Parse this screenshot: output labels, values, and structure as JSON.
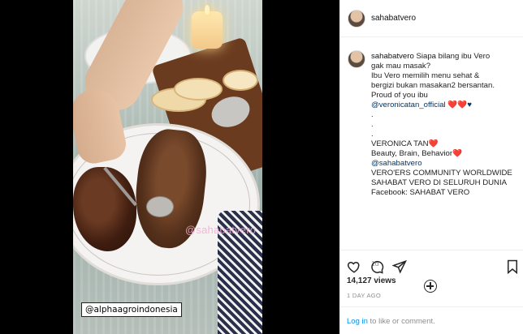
{
  "post": {
    "username": "sahabatvero",
    "watermark": "@sahabatvero",
    "video_tag": "@alphaagroindonesia",
    "caption": {
      "username": "sahabatvero",
      "lines": [
        "Siapa bilang ibu Vero",
        "gak mau masak?",
        "Ibu Vero memilih menu sehat &",
        "bergizi bukan masakan2 bersantan.",
        "Proud of you ibu",
        "@veronicatan_official ❤️❤️♥",
        ".",
        ".",
        ".",
        "VERONICA TAN❤️",
        "Beauty, Brain, Behavior❤️",
        "@sahabatvero",
        "VERO'ERS COMMUNITY WORLDWIDE",
        "SAHABAT VERO DI SELURUH DUNIA",
        "Facebook: SAHABAT VERO"
      ]
    },
    "age_short": "1d",
    "views_label": "14,127 views",
    "age_long": "1 DAY AGO",
    "login_link": "Log in",
    "login_rest": " to like or comment."
  },
  "icons": {
    "heart": "heart-icon",
    "comment": "comment-icon",
    "share": "share-icon",
    "save": "save-icon",
    "more": "plus-circle-icon"
  }
}
